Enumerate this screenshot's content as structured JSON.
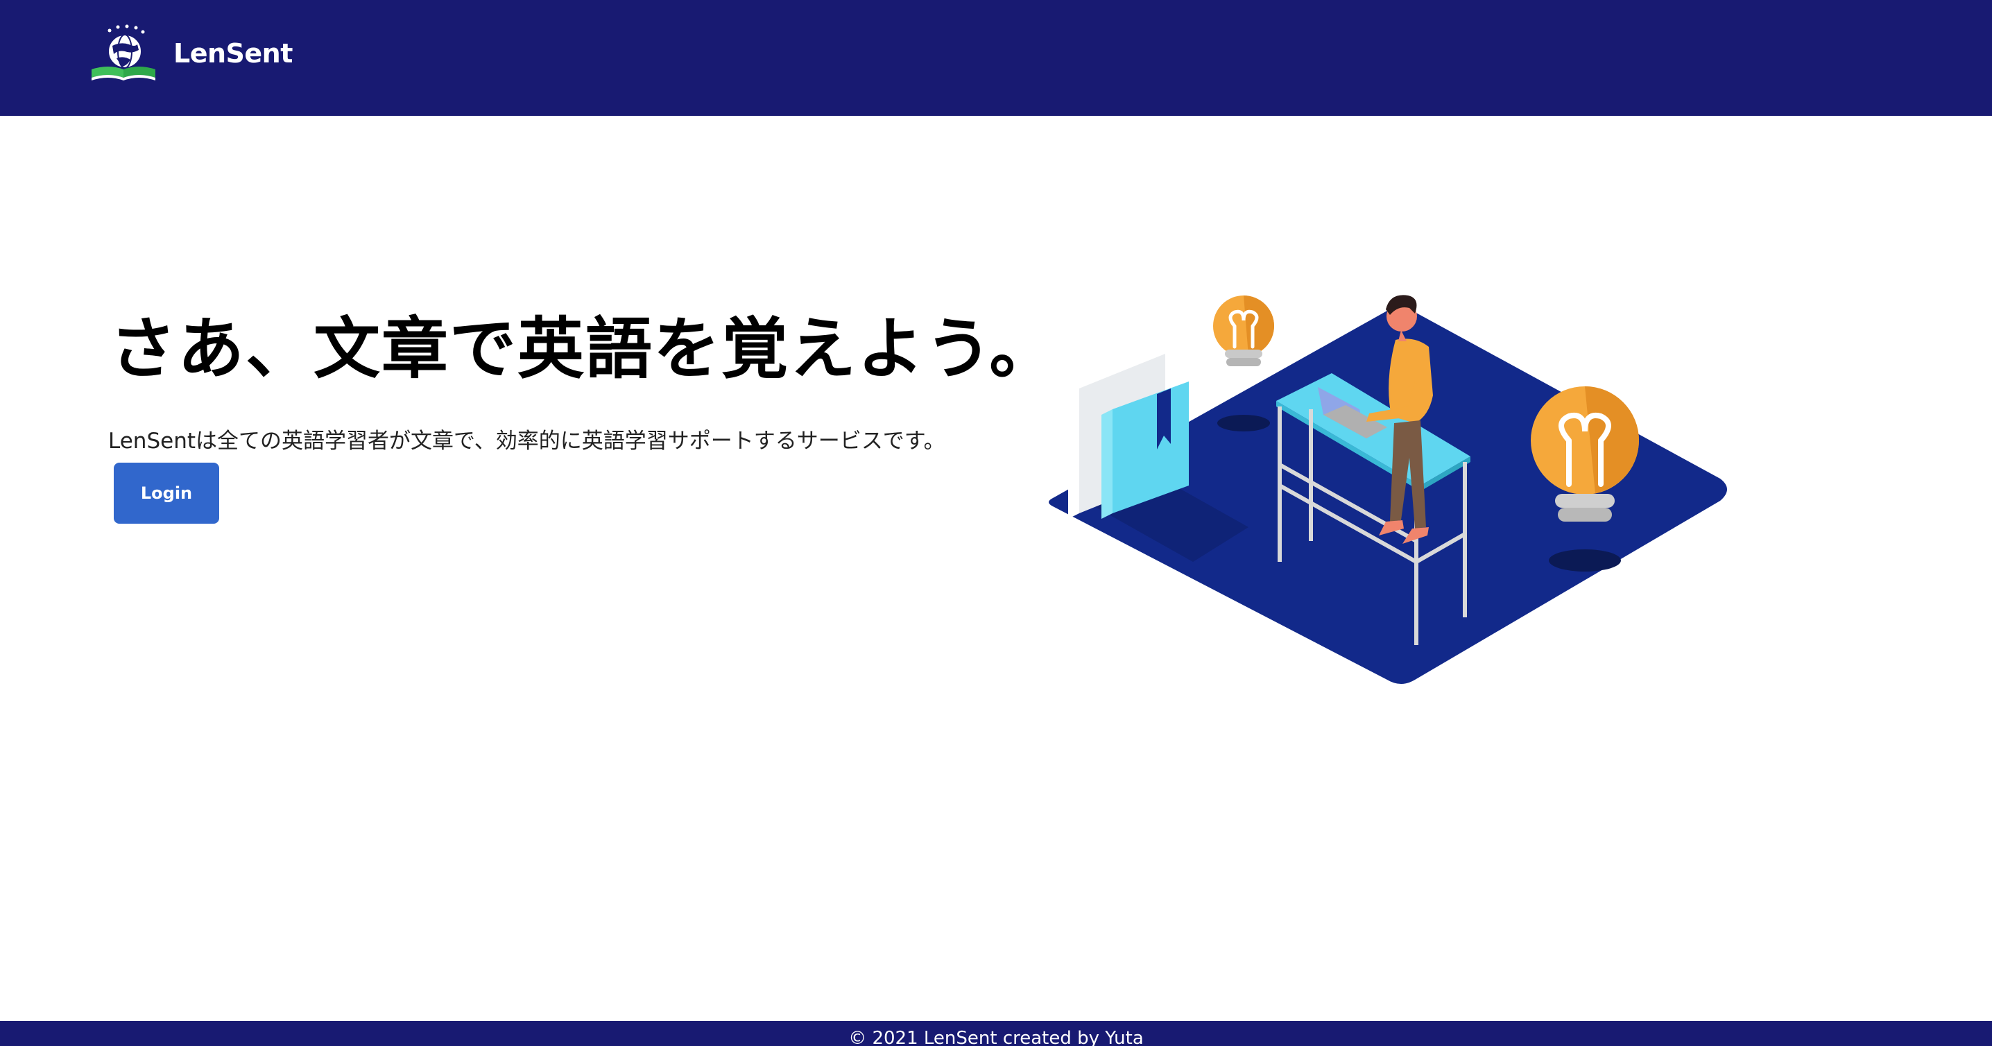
{
  "header": {
    "brand_name": "LenSent",
    "logo_icon": "globe-book-logo-icon"
  },
  "hero": {
    "title": "さあ、文章で英語を覚えよう。",
    "subtitle": "LenSentは全ての英語学習者が文章で、効率的に英語学習サポートするサービスです。",
    "login_label": "Login",
    "illustration": "person-at-standing-desk-with-laptop-books-lightbulbs-illustration"
  },
  "footer": {
    "text": "© 2021 LenSent created by Yuta"
  },
  "colors": {
    "navbar": "#181a72",
    "primary_button": "#3167cc",
    "platform": "#12298a",
    "bulb": "#f5a83b",
    "desk": "#5fd6f0"
  }
}
